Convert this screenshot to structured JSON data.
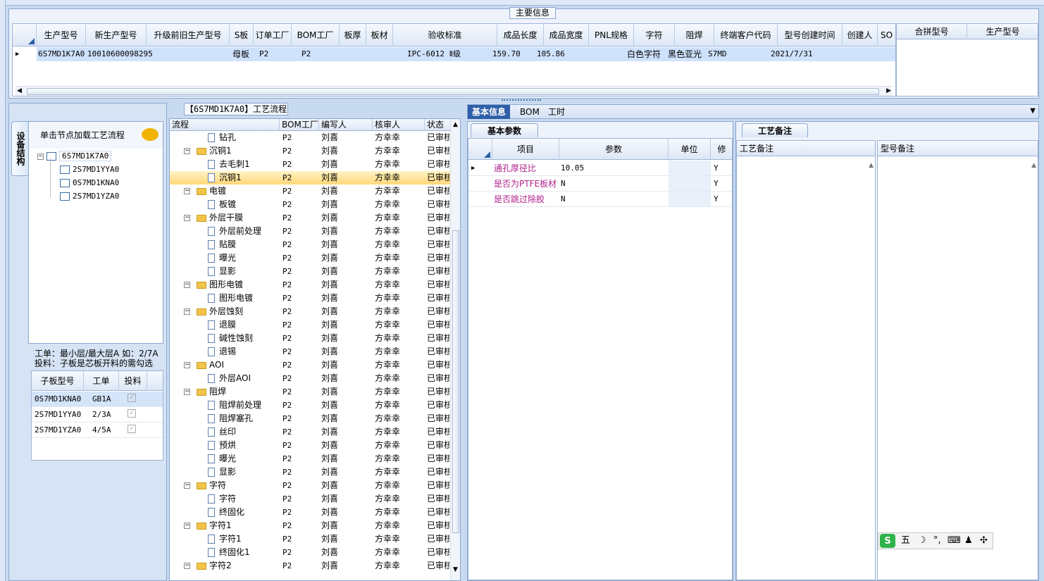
{
  "main_group": {
    "title": "主要信息",
    "columns": [
      "生产型号",
      "新生产型号",
      "升级前旧生产型号",
      "S板",
      "订单工厂",
      "BOM工厂",
      "板厚",
      "板材",
      "验收标准",
      "成品长度",
      "成品宽度",
      "PNL规格",
      "字符",
      "阻焊",
      "终端客户代码",
      "型号创建时间",
      "创建人",
      "SO"
    ],
    "row": {
      "prod_model": "6S7MD1K7A0",
      "new_model": "10010600098295",
      "old_model": "",
      "s_board": "母板",
      "order_factory": "P2",
      "bom_factory": "P2",
      "thickness": "",
      "material": "",
      "standard": "IPC-6012 Ⅱ级",
      "length": "159.70",
      "width": "105.86",
      "pnl": "",
      "char": "白色字符",
      "mask": "黑色亚光",
      "customer": "S7MD",
      "created": "2021/7/31",
      "creator": "",
      "so": ""
    },
    "side_columns": [
      "合拼型号",
      "生产型号"
    ]
  },
  "left_panel": {
    "side_tab": "设备结构",
    "hint": "单击节点加载工艺流程",
    "tree": {
      "root": "6S7MD1K7A0",
      "children": [
        "2S7MD1YYA0",
        "0S7MD1KNA0",
        "2S7MD1YZA0"
      ]
    },
    "note_line1": "工单：最小层/最大层A 如：2/7A",
    "note_line2": "投料：子板是芯板开料的需勾选",
    "sub_table": {
      "columns": [
        "子板型号",
        "工单",
        "投料"
      ],
      "rows": [
        {
          "model": "0S7MD1KNA0",
          "order": "GB1A",
          "feed": "✓"
        },
        {
          "model": "2S7MD1YYA0",
          "order": "2/3A",
          "feed": "✓"
        },
        {
          "model": "2S7MD1YZA0",
          "order": "4/5A",
          "feed": "✓"
        }
      ]
    }
  },
  "flow_panel": {
    "title": "【6S7MD1K7A0】工艺流程",
    "columns": [
      "流程",
      "BOM工厂",
      "编写人",
      "核审人",
      "状态"
    ],
    "rows": [
      {
        "name": "钻孔",
        "type": "doc",
        "bom": "P2",
        "writer": "刘喜",
        "auditor": "方幸幸",
        "status": "已审核"
      },
      {
        "name": "沉铜1",
        "type": "folder",
        "bom": "P2",
        "writer": "刘喜",
        "auditor": "方幸幸",
        "status": "已审核"
      },
      {
        "name": "去毛刺1",
        "type": "doc",
        "bom": "P2",
        "writer": "刘喜",
        "auditor": "方幸幸",
        "status": "已审核"
      },
      {
        "name": "沉铜1",
        "type": "doc",
        "bom": "P2",
        "writer": "刘喜",
        "auditor": "方幸幸",
        "status": "已审核",
        "selected": true
      },
      {
        "name": "电镀",
        "type": "folder",
        "bom": "P2",
        "writer": "刘喜",
        "auditor": "方幸幸",
        "status": "已审核"
      },
      {
        "name": "板镀",
        "type": "doc",
        "bom": "P2",
        "writer": "刘喜",
        "auditor": "方幸幸",
        "status": "已审核"
      },
      {
        "name": "外层干膜",
        "type": "folder",
        "bom": "P2",
        "writer": "刘喜",
        "auditor": "方幸幸",
        "status": "已审核"
      },
      {
        "name": "外层前处理",
        "type": "doc",
        "bom": "P2",
        "writer": "刘喜",
        "auditor": "方幸幸",
        "status": "已审核"
      },
      {
        "name": "贴膜",
        "type": "doc",
        "bom": "P2",
        "writer": "刘喜",
        "auditor": "方幸幸",
        "status": "已审核"
      },
      {
        "name": "曝光",
        "type": "doc",
        "bom": "P2",
        "writer": "刘喜",
        "auditor": "方幸幸",
        "status": "已审核"
      },
      {
        "name": "显影",
        "type": "doc",
        "bom": "P2",
        "writer": "刘喜",
        "auditor": "方幸幸",
        "status": "已审核"
      },
      {
        "name": "图形电镀",
        "type": "folder",
        "bom": "P2",
        "writer": "刘喜",
        "auditor": "方幸幸",
        "status": "已审核"
      },
      {
        "name": "图形电镀",
        "type": "doc",
        "bom": "P2",
        "writer": "刘喜",
        "auditor": "方幸幸",
        "status": "已审核"
      },
      {
        "name": "外层蚀刻",
        "type": "folder",
        "bom": "P2",
        "writer": "刘喜",
        "auditor": "方幸幸",
        "status": "已审核"
      },
      {
        "name": "退膜",
        "type": "doc",
        "bom": "P2",
        "writer": "刘喜",
        "auditor": "方幸幸",
        "status": "已审核"
      },
      {
        "name": "碱性蚀刻",
        "type": "doc",
        "bom": "P2",
        "writer": "刘喜",
        "auditor": "方幸幸",
        "status": "已审核"
      },
      {
        "name": "退锡",
        "type": "doc",
        "bom": "P2",
        "writer": "刘喜",
        "auditor": "方幸幸",
        "status": "已审核"
      },
      {
        "name": "AOI",
        "type": "folder",
        "bom": "P2",
        "writer": "刘喜",
        "auditor": "方幸幸",
        "status": "已审核"
      },
      {
        "name": "外层AOI",
        "type": "doc",
        "bom": "P2",
        "writer": "刘喜",
        "auditor": "方幸幸",
        "status": "已审核"
      },
      {
        "name": "阻焊",
        "type": "folder",
        "bom": "P2",
        "writer": "刘喜",
        "auditor": "方幸幸",
        "status": "已审核"
      },
      {
        "name": "阻焊前处理",
        "type": "doc",
        "bom": "P2",
        "writer": "刘喜",
        "auditor": "方幸幸",
        "status": "已审核"
      },
      {
        "name": "阻焊塞孔",
        "type": "doc",
        "bom": "P2",
        "writer": "刘喜",
        "auditor": "方幸幸",
        "status": "已审核"
      },
      {
        "name": "丝印",
        "type": "doc",
        "bom": "P2",
        "writer": "刘喜",
        "auditor": "方幸幸",
        "status": "已审核"
      },
      {
        "name": "预烘",
        "type": "doc",
        "bom": "P2",
        "writer": "刘喜",
        "auditor": "方幸幸",
        "status": "已审核"
      },
      {
        "name": "曝光",
        "type": "doc",
        "bom": "P2",
        "writer": "刘喜",
        "auditor": "方幸幸",
        "status": "已审核"
      },
      {
        "name": "显影",
        "type": "doc",
        "bom": "P2",
        "writer": "刘喜",
        "auditor": "方幸幸",
        "status": "已审核"
      },
      {
        "name": "字符",
        "type": "folder",
        "bom": "P2",
        "writer": "刘喜",
        "auditor": "方幸幸",
        "status": "已审核"
      },
      {
        "name": "字符",
        "type": "doc",
        "bom": "P2",
        "writer": "刘喜",
        "auditor": "方幸幸",
        "status": "已审核"
      },
      {
        "name": "终固化",
        "type": "doc",
        "bom": "P2",
        "writer": "刘喜",
        "auditor": "方幸幸",
        "status": "已审核"
      },
      {
        "name": "字符1",
        "type": "folder",
        "bom": "P2",
        "writer": "刘喜",
        "auditor": "方幸幸",
        "status": "已审核"
      },
      {
        "name": "字符1",
        "type": "doc",
        "bom": "P2",
        "writer": "刘喜",
        "auditor": "方幸幸",
        "status": "已审核"
      },
      {
        "name": "终固化1",
        "type": "doc",
        "bom": "P2",
        "writer": "刘喜",
        "auditor": "方幸幸",
        "status": "已审核"
      },
      {
        "name": "字符2",
        "type": "folder",
        "bom": "P2",
        "writer": "刘喜",
        "auditor": "方幸幸",
        "status": "已审核"
      }
    ]
  },
  "info_tabs": {
    "tabs": [
      "基本信息",
      "BOM",
      "工时"
    ],
    "subtab": "基本参数",
    "columns": [
      "项目",
      "参数",
      "单位",
      "修"
    ],
    "rows": [
      {
        "item": "通孔厚径比",
        "value": "10.05",
        "unit": "",
        "mod": "Y"
      },
      {
        "item": "是否为PTFE板材",
        "value": "N",
        "unit": "",
        "mod": "Y"
      },
      {
        "item": "是否跳过除胶",
        "value": "N",
        "unit": "",
        "mod": "Y"
      }
    ]
  },
  "notes_panel": {
    "subtab": "工艺备注",
    "col1": "工艺备注",
    "col2": "型号备注"
  },
  "ime": {
    "mode": "五"
  }
}
